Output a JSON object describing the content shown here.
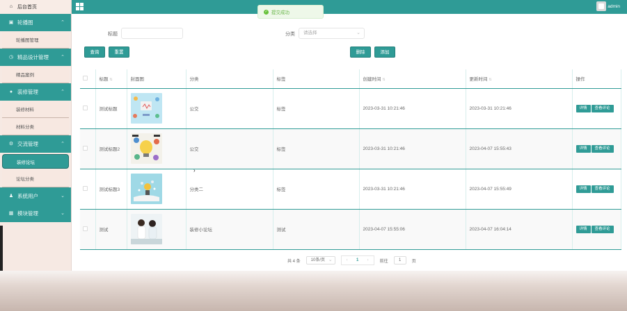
{
  "sidebar": {
    "home": "后台首页",
    "groups": [
      {
        "label": "轮播图",
        "items": [
          "轮播图管理"
        ]
      },
      {
        "label": "精品设计管理",
        "items": [
          "精品案例"
        ]
      },
      {
        "label": "装修管理",
        "items": [
          "装修材料",
          "材料分类"
        ]
      },
      {
        "label": "交流管理",
        "items": [
          "装修论坛",
          "论坛分类"
        ]
      },
      {
        "label": "系统用户",
        "items": []
      },
      {
        "label": "模块管理",
        "items": []
      }
    ]
  },
  "topbar": {
    "title": "",
    "user": "admin"
  },
  "toast": "提交成功",
  "search": {
    "title_label": "标题",
    "title_placeholder": "",
    "category_label": "分类",
    "category_placeholder": "请选择"
  },
  "buttons": {
    "query": "查询",
    "reset": "重置",
    "delete": "删除",
    "add": "添加"
  },
  "table": {
    "headers": [
      "标题",
      "封面图",
      "分类",
      "标签",
      "创建时间",
      "更新时间",
      "操作"
    ],
    "rows": [
      {
        "title": "测试标题",
        "category": "公交",
        "tag": "标签",
        "created": "2023-03-31 10:21:46",
        "updated": "2023-03-31 10:21:46"
      },
      {
        "title": "测试标题2",
        "category": "公交",
        "tag": "标签",
        "created": "2023-03-31 10:21:46",
        "updated": "2023-04-07 15:55:43"
      },
      {
        "title": "测试标题3",
        "category": "分类二",
        "tag": "标签",
        "created": "2023-03-31 10:21:46",
        "updated": "2023-04-07 15:55:49"
      },
      {
        "title": "测试",
        "category": "装修小论坛",
        "tag": "测试",
        "created": "2023-04-07 15:55:06",
        "updated": "2023-04-07 16:04:14"
      }
    ],
    "actions": {
      "detail": "详情",
      "comments": "查看评论"
    }
  },
  "pager": {
    "total": "共 4 条",
    "size": "10条/页",
    "current": "1",
    "goto": "前往",
    "goto_value": "1",
    "page_unit": "页"
  },
  "colors": {
    "accent": "#2f9b96",
    "sidebar_bg": "#f6e9e3"
  }
}
